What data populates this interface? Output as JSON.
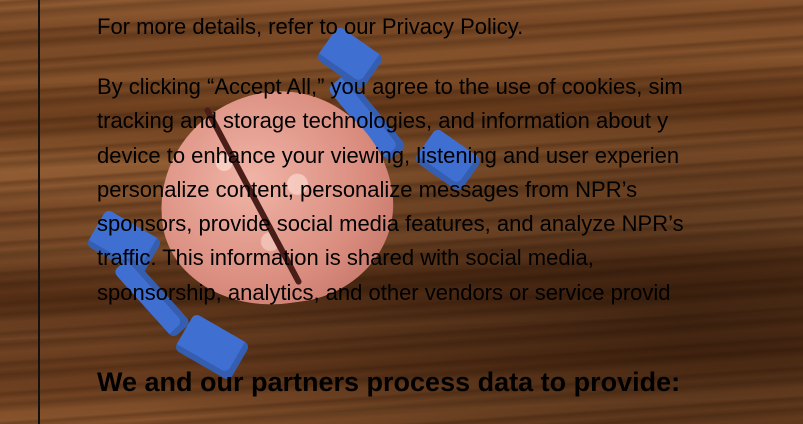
{
  "policy_line": "For more details, refer to our Privacy Policy.",
  "paragraph_lines": [
    "By clicking “Accept All,” you agree to the use of cookies, sim",
    "tracking and storage technologies, and information about y",
    "device to enhance your viewing, listening and user experien",
    "personalize content, personalize messages from NPR’s",
    "sponsors, provide social media features, and analyze NPR’s",
    "traffic. This information is shared with social media,",
    "sponsorship, analytics, and other vendors or service provid"
  ],
  "heading": "We and our partners process data to provide:",
  "colors": {
    "text": "#000000",
    "dumbbell": "#3f6fd1"
  },
  "background_icons": [
    "brain-image",
    "dumbbell-image"
  ]
}
